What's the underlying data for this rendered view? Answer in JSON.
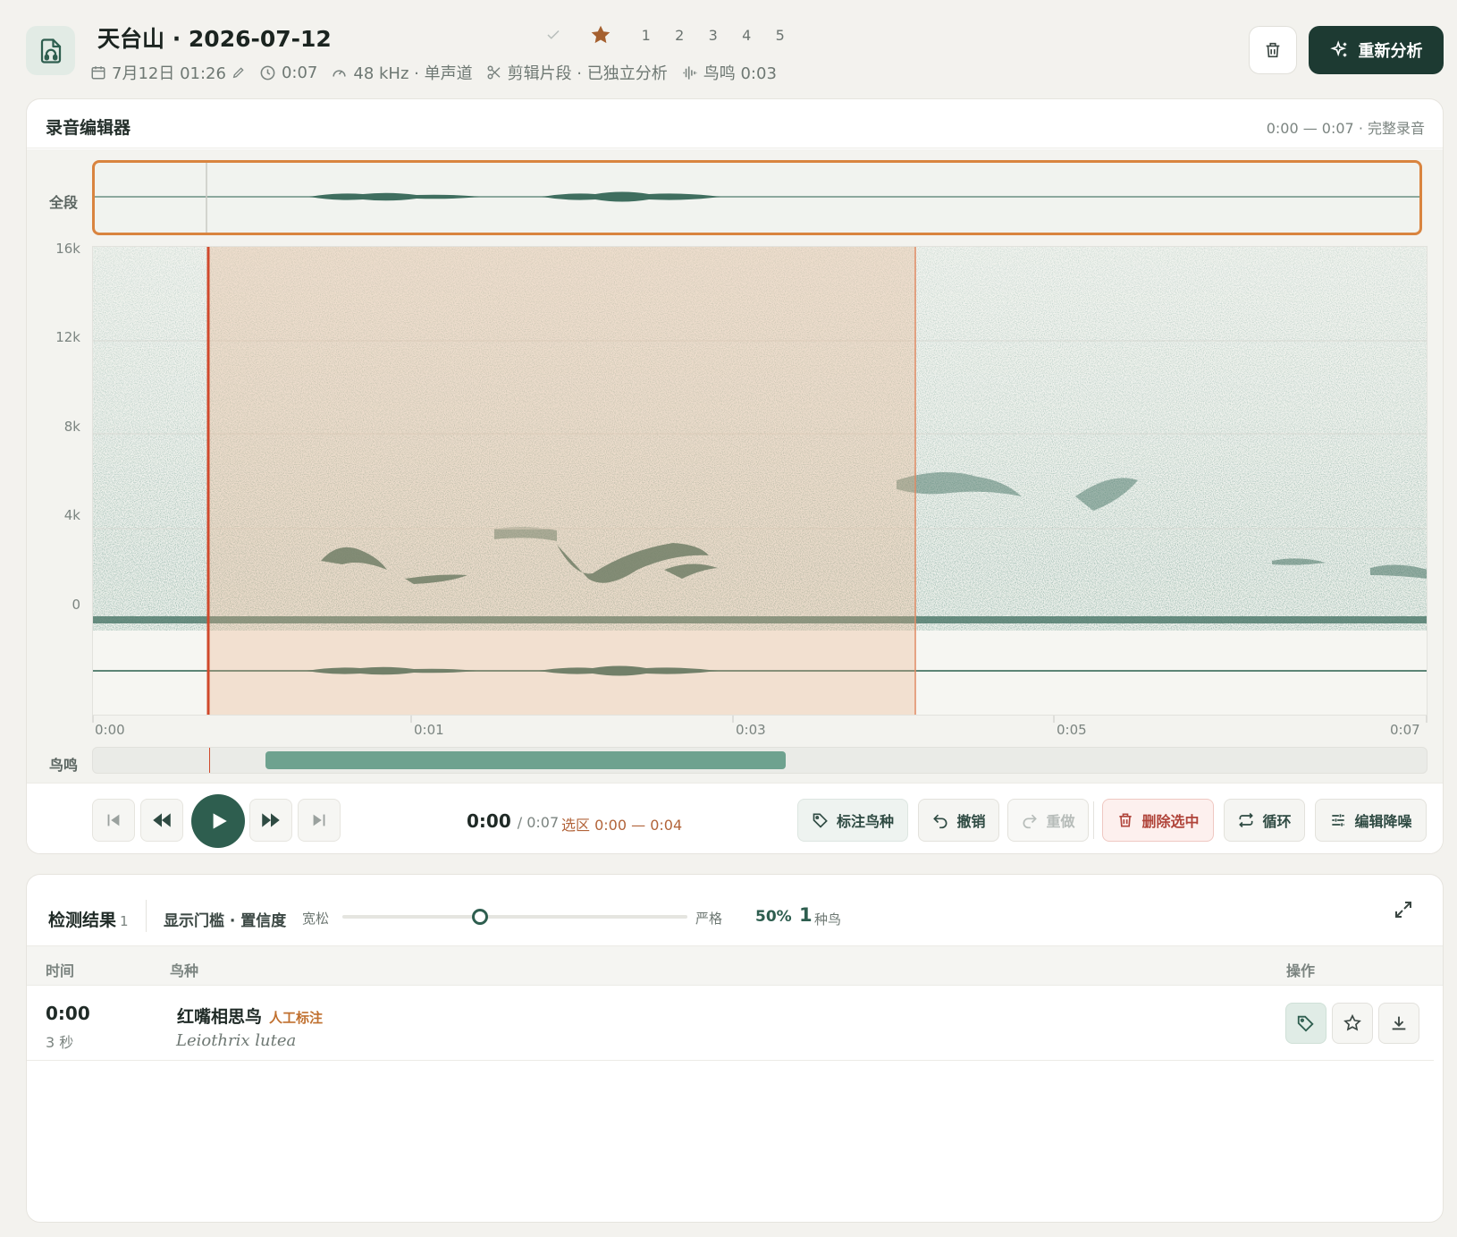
{
  "header": {
    "title": "天台山 · 2026-07-12",
    "date": "7月12日 01:26",
    "duration": "0:07",
    "audio_format": "48 kHz · 单声道",
    "clip_status": "剪辑片段 · 已独立分析",
    "birdsong": "鸟鸣 0:03",
    "rating_levels": [
      "1",
      "2",
      "3",
      "4",
      "5"
    ],
    "reanalyze_label": "重新分析"
  },
  "editor": {
    "title": "录音编辑器",
    "range_info": "0:00 — 0:07 · 完整录音",
    "overview_label": "全段",
    "freq_axis_labels": [
      "16k",
      "12k",
      "8k",
      "4k",
      "0"
    ],
    "time_axis_labels": [
      "0:00",
      "0:01",
      "0:03",
      "0:05",
      "0:07"
    ],
    "bird_track_label": "鸟鸣",
    "playhead_fraction": 0.087,
    "selection_fraction": [
      0.087,
      0.617
    ],
    "birdsong_segment_fraction": [
      0.13,
      0.52
    ]
  },
  "transport": {
    "current_time": "0:00",
    "total_time": "/ 0:07",
    "selection_text": "选区 0:00 — 0:04",
    "tag_species": "标注鸟种",
    "undo": "撤销",
    "redo": "重做",
    "delete_selection": "删除选中",
    "loop": "循环",
    "edit_denoise": "编辑降噪"
  },
  "results": {
    "title": "检测结果",
    "count": "1",
    "threshold_label": "显示门槛 · 置信度",
    "lax_label": "宽松",
    "strict_label": "严格",
    "threshold_value_fraction": 0.4,
    "threshold_percent": "50%",
    "species_count": "1",
    "species_unit": "种鸟",
    "columns": {
      "time": "时间",
      "species": "鸟种",
      "actions": "操作"
    },
    "rows": [
      {
        "time": "0:00",
        "duration": "3 秒",
        "name": "红嘴相思鸟",
        "badge": "人工标注",
        "latin": "Leiothrix lutea"
      }
    ]
  },
  "colors": {
    "accent_dark": "#1d3a32",
    "accent_green": "#2e5e4f",
    "selection_orange": "#d9843f",
    "playhead_red": "#d0492c",
    "badge_orange": "#c0702f"
  }
}
